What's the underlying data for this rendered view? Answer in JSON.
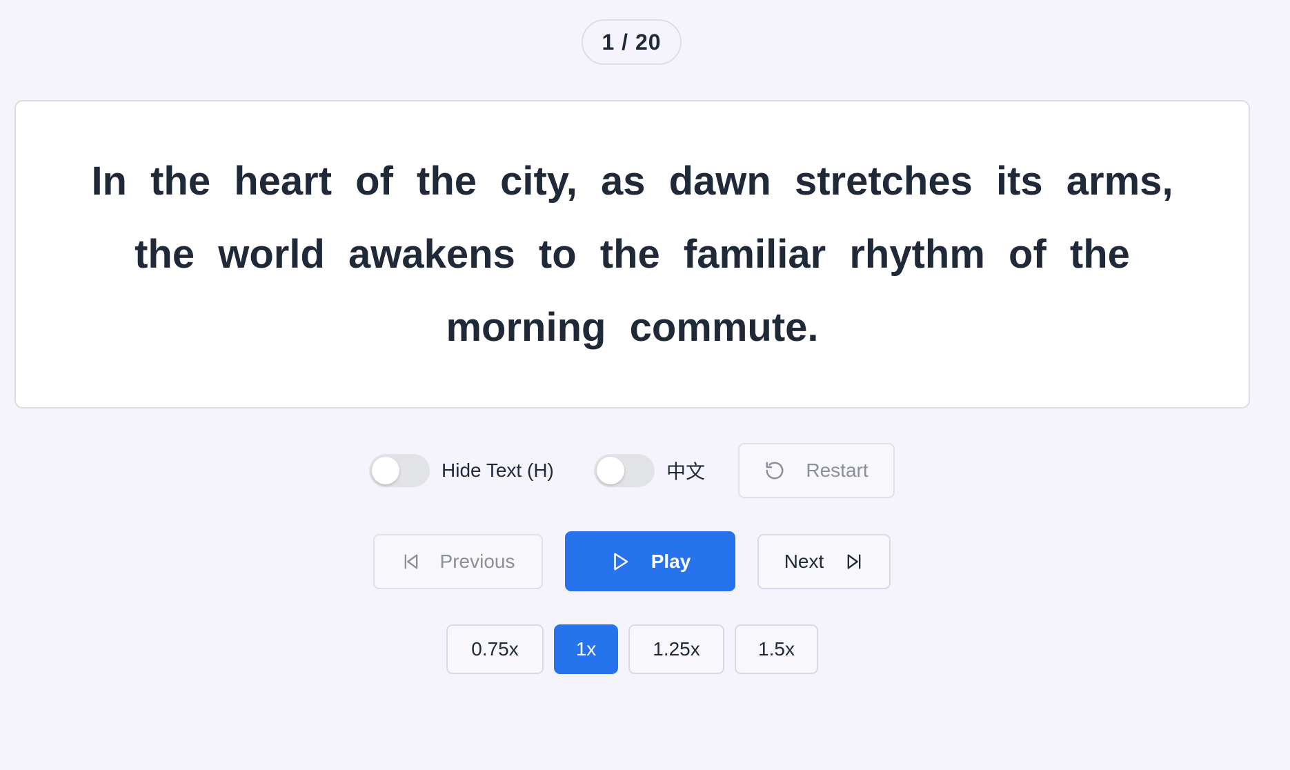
{
  "progress": {
    "label": "1 / 20"
  },
  "sentence": {
    "text": "In the heart of the city, as dawn stretches its arms, the world awakens to the familiar rhythm of the morning commute."
  },
  "options": {
    "hide_text": {
      "label": "Hide Text (H)",
      "checked": false
    },
    "chinese": {
      "label": "中文",
      "checked": false
    },
    "restart_label": "Restart"
  },
  "navigation": {
    "previous_label": "Previous",
    "play_label": "Play",
    "next_label": "Next"
  },
  "speeds": {
    "options": [
      "0.75x",
      "1x",
      "1.25x",
      "1.5x"
    ],
    "selected": "1x"
  },
  "colors": {
    "accent": "#2673ed",
    "background": "#f5f4fd",
    "text": "#1f2937",
    "muted": "#8a8f99"
  },
  "icons": {
    "restart": "rotate-ccw-icon",
    "previous": "skip-back-icon",
    "play": "play-icon",
    "next": "skip-forward-icon"
  }
}
